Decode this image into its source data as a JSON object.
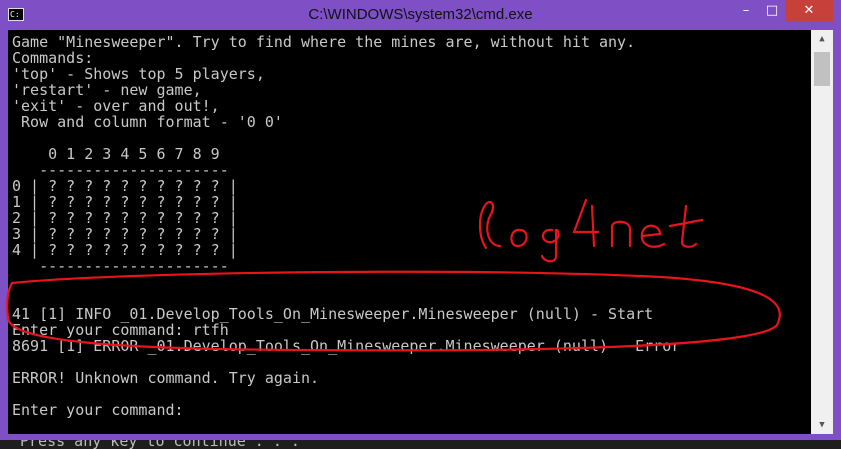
{
  "window": {
    "title": "C:\\WINDOWS\\system32\\cmd.exe",
    "icon": "cmd-icon",
    "controls": {
      "minimize": "minimize-icon",
      "maximize": "maximize-icon",
      "close": "close-icon"
    }
  },
  "console": {
    "lines": [
      "Game \"Minesweeper\". Try to find where the mines are, without hit any.",
      "Commands:",
      "'top' - Shows top 5 players,",
      "'restart' - new game,",
      "'exit' - over and out!,",
      " Row and column format - '0 0'",
      "",
      "    0 1 2 3 4 5 6 7 8 9",
      "   ---------------------",
      "0 | ? ? ? ? ? ? ? ? ? ? |",
      "1 | ? ? ? ? ? ? ? ? ? ? |",
      "2 | ? ? ? ? ? ? ? ? ? ? |",
      "3 | ? ? ? ? ? ? ? ? ? ? |",
      "4 | ? ? ? ? ? ? ? ? ? ? |",
      "   ---------------------",
      "",
      "",
      "41 [1] INFO _01.Develop_Tools_On_Minesweeper.Minesweeper (null) - Start",
      "Enter your command: rtfh",
      "8691 [1] ERROR _01.Develop_Tools_On_Minesweeper.Minesweeper (null) - Error",
      "",
      "ERROR! Unknown command. Try again.",
      "",
      "Enter your command:"
    ]
  },
  "annotation": {
    "text": "log4net",
    "color": "#e8141c"
  },
  "background_text": "Press any key to continue . . .",
  "colors": {
    "titlebar": "#7f4fc6",
    "console_bg": "#000000",
    "console_fg": "#c8c8c8",
    "close_btn": "#c7403a"
  }
}
